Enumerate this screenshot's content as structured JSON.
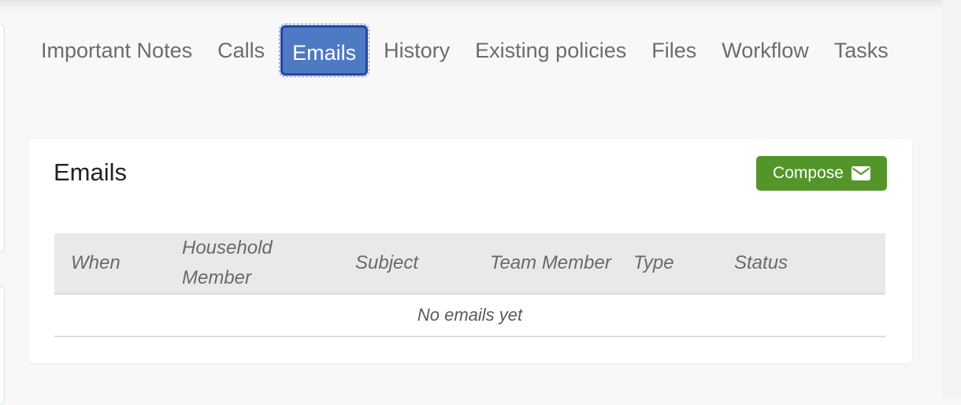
{
  "tabs": [
    {
      "label": "Important Notes",
      "active": false
    },
    {
      "label": "Calls",
      "active": false
    },
    {
      "label": "Emails",
      "active": true
    },
    {
      "label": "History",
      "active": false
    },
    {
      "label": "Existing policies",
      "active": false
    },
    {
      "label": "Files",
      "active": false
    },
    {
      "label": "Workflow",
      "active": false
    },
    {
      "label": "Tasks",
      "active": false
    }
  ],
  "card": {
    "title": "Emails",
    "compose_label": "Compose",
    "compose_icon": "envelope-icon"
  },
  "table": {
    "columns": [
      "When",
      "Household Member",
      "Subject",
      "Team Member",
      "Type",
      "Status"
    ],
    "empty_message": "No emails yet"
  },
  "colors": {
    "active_tab": "#4e79c3",
    "active_tab_border": "#2745a6",
    "compose_button": "#54952a",
    "tab_text": "#6c6c6c",
    "table_header_bg": "#e9e9e9"
  }
}
